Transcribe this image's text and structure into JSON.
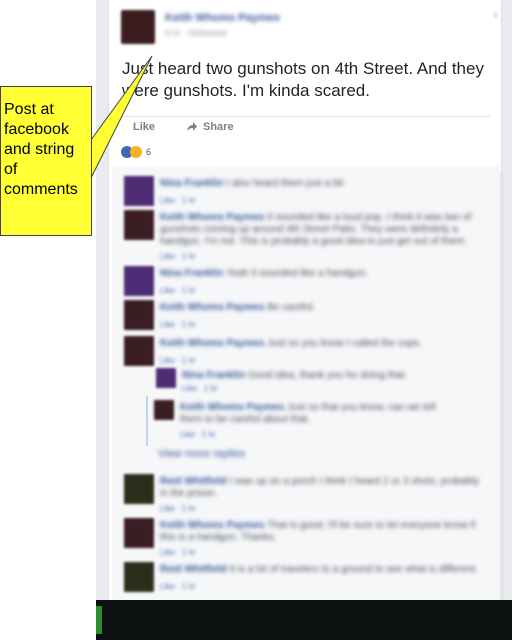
{
  "post": {
    "author": "Keith Whoms Paymes",
    "timestamp": "6 hr · Delivered",
    "options": "∨",
    "text": "Just heard two gunshots on 4th Street. And they were gunshots. I'm kinda scared.",
    "actions": {
      "like_label": "Like",
      "share_label": "Share"
    },
    "reactions": {
      "count": "6"
    }
  },
  "comments": [
    {
      "name": "Nina Franklin",
      "text": "I also heard them just a bit",
      "meta": "Like · 1 hr",
      "avatar_color": "#4e2b75"
    },
    {
      "name": "Keith Whoms Paymes",
      "text": "It sounded like a loud pop. I think it was two of gunshots coming up around 4th Street Patio. They were definitely a handgun. I'm not. This is probably a good idea to just get out of there.",
      "meta": "Like · 1 hr",
      "avatar_color": "#3a1e23"
    },
    {
      "name": "Nina Franklin",
      "text": "Yeah it sounded like a handgun.",
      "meta": "Like · 1 hr",
      "avatar_color": "#4e2b75"
    },
    {
      "name": "Keith Whoms Paymes",
      "text": "Be careful.",
      "meta": "Like · 1 hr",
      "avatar_color": "#3a1e23"
    },
    {
      "name": "Keith Whoms Paymes",
      "text": "Just so you know I called the cops.",
      "meta": "Like · 1 hr",
      "avatar_color": "#3a1e23"
    },
    {
      "name": "Nina Franklin",
      "text": "Good idea, thank you for doing that.",
      "meta": "Like · 1 hr",
      "avatar_color": "#4e2b75"
    },
    {
      "name": "Keith Whoms Paymes",
      "text": "Just so that you know, can we tell them to be careful about that.",
      "meta": "Like · 1 hr",
      "avatar_color": "#3a1e23"
    },
    {
      "name": "Reid Whitfield",
      "text": "I was up on a porch I think I heard 2 or 3 shots, probably in the prison.",
      "meta": "Like · 1 hr",
      "avatar_color": "#2d2d1c"
    },
    {
      "name": "Keith Whoms Paymes",
      "text": "That is good. I'll be sure to let everyone know if this is a handgun. Thanks.",
      "meta": "Like · 1 hr",
      "avatar_color": "#3a1e23"
    },
    {
      "name": "Reid Whitfield",
      "text": "It is a lot of travelers to a ground to see what is different.",
      "meta": "Like · 1 hr",
      "avatar_color": "#2d2d1c"
    }
  ],
  "view_replies_label": "View more replies",
  "callout": {
    "text": "Post at facebook and string of comments",
    "background": "#ffff33"
  },
  "colors": {
    "link_blue": "#365899",
    "page_background": "#e9ebee",
    "like_blue": "#4267b2"
  }
}
